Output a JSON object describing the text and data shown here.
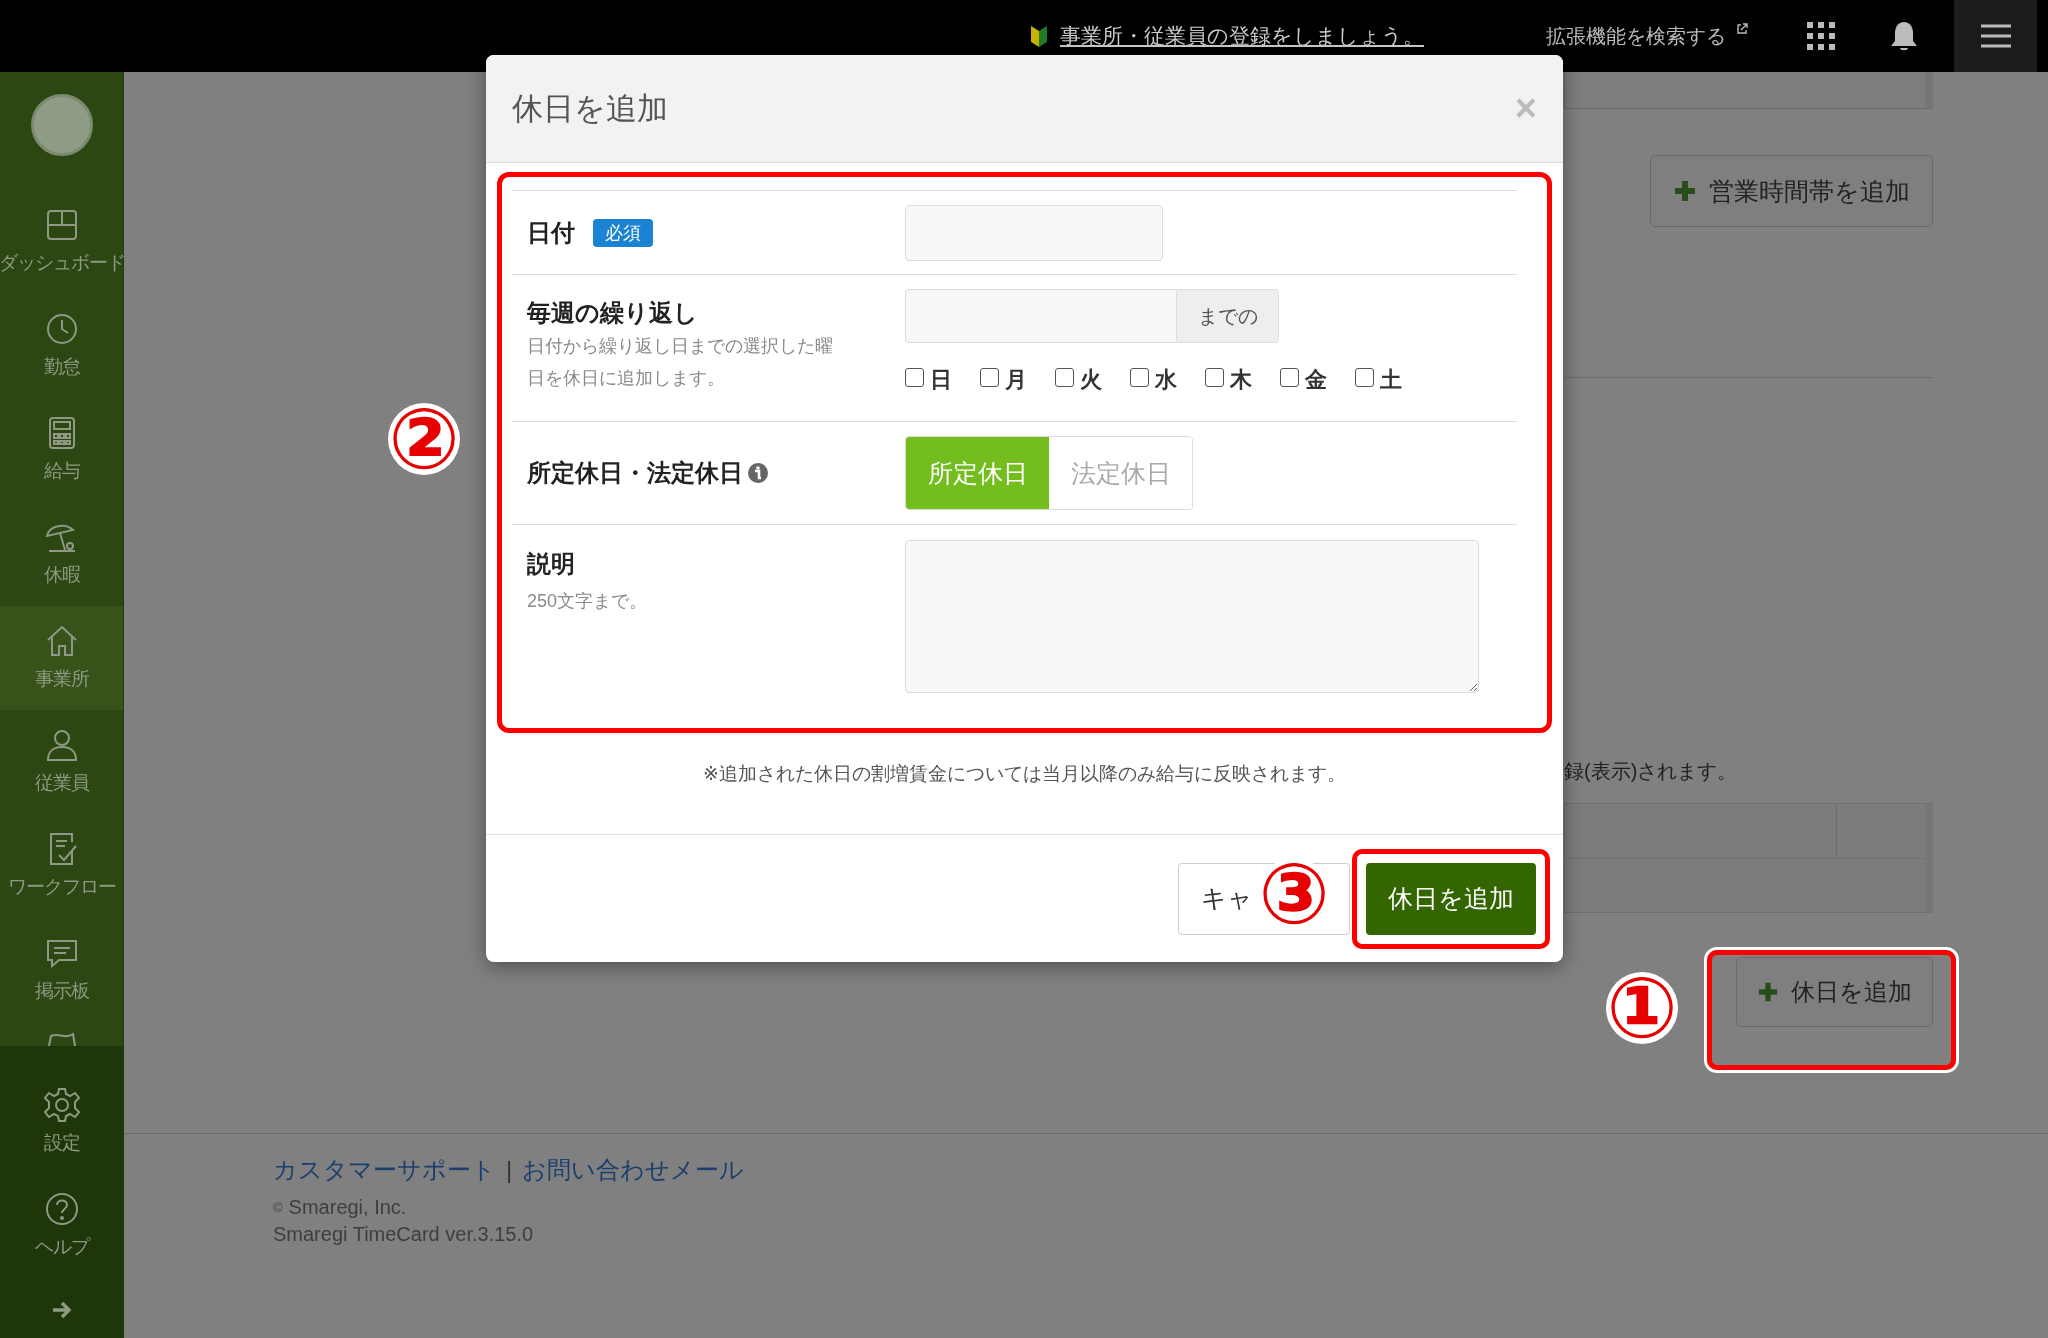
{
  "top_bar": {
    "notice": "事業所・従業員の登録をしましょう。",
    "extensions_link": "拡張機能を検索する"
  },
  "sidebar": {
    "items": [
      {
        "kind": "dashboard",
        "label": "ダッシュボード",
        "selected": false
      },
      {
        "kind": "clock",
        "label": "勤怠",
        "selected": false
      },
      {
        "kind": "calculator",
        "label": "給与",
        "selected": false
      },
      {
        "kind": "umbrella",
        "label": "休暇",
        "selected": false
      },
      {
        "kind": "home",
        "label": "事業所",
        "selected": true
      },
      {
        "kind": "person",
        "label": "従業員",
        "selected": false
      },
      {
        "kind": "checklist",
        "label": "ワークフロー",
        "selected": false
      },
      {
        "kind": "chat",
        "label": "掲示板",
        "selected": false
      }
    ],
    "bottom_items": [
      {
        "kind": "gear",
        "label": "設定"
      },
      {
        "kind": "help",
        "label": "ヘルプ"
      }
    ]
  },
  "page": {
    "add_hours_button": "営業時間帯を追加",
    "notice_fragment": "録(表示)されます。",
    "add_holiday_button": "休日を追加"
  },
  "footer": {
    "links": [
      "カスタマーサポート",
      "お問い合わせメール"
    ],
    "separator": "|",
    "copyright_mark": "©",
    "copyright": "Smaregi, Inc.",
    "version": "Smaregi TimeCard ver.3.15.0"
  },
  "modal": {
    "title": "休日を追加",
    "close": "×",
    "date": {
      "label": "日付",
      "badge": "必須"
    },
    "repeat": {
      "label": "毎週の繰り返し",
      "hint": "日付から繰り返し日までの選択した曜日を休日に追加します。",
      "addon": "までの",
      "weekdays": [
        {
          "label": "日",
          "checked": false
        },
        {
          "label": "月",
          "checked": false
        },
        {
          "label": "火",
          "checked": false
        },
        {
          "label": "水",
          "checked": false
        },
        {
          "label": "木",
          "checked": false
        },
        {
          "label": "金",
          "checked": false
        },
        {
          "label": "土",
          "checked": false
        }
      ]
    },
    "holiday_type": {
      "label": "所定休日・法定休日",
      "options": [
        {
          "label": "所定休日",
          "selected": true
        },
        {
          "label": "法定休日",
          "selected": false
        }
      ]
    },
    "description": {
      "label": "説明",
      "hint": "250文字まで。"
    },
    "note": "※追加された休日の割増賃金については当月以降のみ給与に反映されます。",
    "cancel_button": "キャ",
    "submit_button": "休日を追加"
  },
  "annotations": [
    {
      "number": "①"
    },
    {
      "number": "②"
    },
    {
      "number": "③"
    }
  ]
}
